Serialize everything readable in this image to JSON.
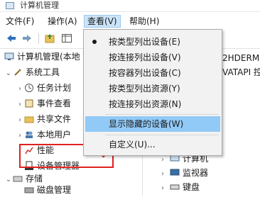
{
  "window": {
    "title": "计算机管理"
  },
  "menubar": {
    "items": [
      {
        "label": "文件(F)"
      },
      {
        "label": "操作(A)"
      },
      {
        "label": "查看(V)"
      },
      {
        "label": "帮助(H)"
      }
    ]
  },
  "dropdown": {
    "items": [
      {
        "label": "按类型列出设备(E)",
        "checked": true
      },
      {
        "label": "按连接列出设备(V)"
      },
      {
        "label": "按容器列出设备(C)"
      },
      {
        "label": "按类型列出资源(Y)"
      },
      {
        "label": "按连接列出资源(N)"
      },
      {
        "label": "显示隐藏的设备(W)",
        "highlighted": true
      },
      {
        "label": "自定义(U)..."
      }
    ]
  },
  "tree": {
    "root": "计算机管理(本地",
    "system_tools": "系统工具",
    "items": [
      {
        "label": "任务计划"
      },
      {
        "label": "事件查看"
      },
      {
        "label": "共享文件"
      },
      {
        "label": "本地用户"
      },
      {
        "label": "性能"
      },
      {
        "label": "设备管理器"
      }
    ],
    "storage": "存储",
    "disk_mgmt": "磁盘管理"
  },
  "right_pane": {
    "top_lines": [
      "2HDERM",
      "VATAPI 控"
    ],
    "items": [
      {
        "label": "计算机"
      },
      {
        "label": "监视器"
      },
      {
        "label": "键盘"
      }
    ]
  },
  "colors": {
    "menu_active_bg": "#cce4f7",
    "highlight_item_bg": "#91c9f7",
    "annotation_red": "#e02020"
  }
}
